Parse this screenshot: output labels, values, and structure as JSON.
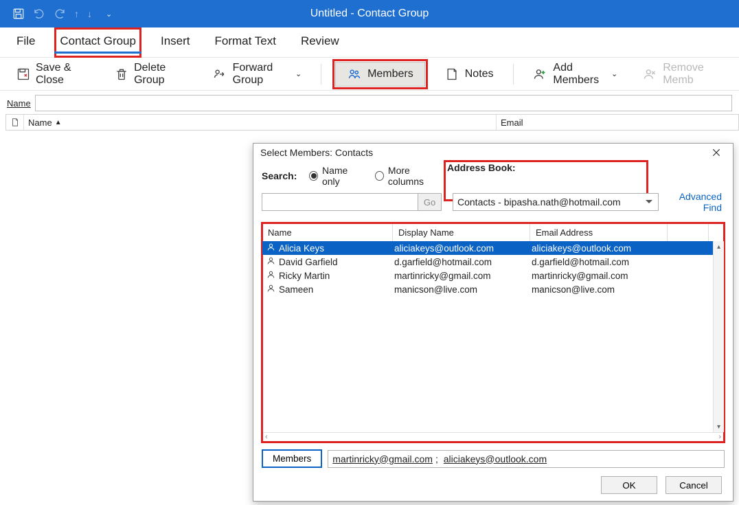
{
  "title": "Untitled  -  Contact Group",
  "tabs": {
    "file": "File",
    "contact_group": "Contact Group",
    "insert": "Insert",
    "format_text": "Format Text",
    "review": "Review"
  },
  "ribbon": {
    "save_close": "Save & Close",
    "delete_group": "Delete Group",
    "forward_group": "Forward Group",
    "members": "Members",
    "notes": "Notes",
    "add_members": "Add Members",
    "remove_member": "Remove Memb"
  },
  "name_row": {
    "label": "Name",
    "value": ""
  },
  "columns": {
    "name": "Name",
    "email": "Email"
  },
  "dialog": {
    "title": "Select Members: Contacts",
    "search_label": "Search:",
    "radio_name_only": "Name only",
    "radio_more_cols": "More columns",
    "ab_label": "Address Book:",
    "go": "Go",
    "ab_value": "Contacts - bipasha.nath@hotmail.com",
    "adv_find": "Advanced Find",
    "headers": {
      "name": "Name",
      "display_name": "Display Name",
      "email": "Email Address"
    },
    "rows": [
      {
        "name": "Alicia Keys",
        "display": "aliciakeys@outlook.com",
        "email": "aliciakeys@outlook.com",
        "selected": true
      },
      {
        "name": "David Garfield",
        "display": "d.garfield@hotmail.com",
        "email": "d.garfield@hotmail.com",
        "selected": false
      },
      {
        "name": "Ricky Martin",
        "display": "martinricky@gmail.com",
        "email": "martinricky@gmail.com",
        "selected": false
      },
      {
        "name": "Sameen",
        "display": "manicson@live.com",
        "email": "manicson@live.com",
        "selected": false
      }
    ],
    "members_btn": "Members",
    "members_value_1": "martinricky@gmail.com",
    "members_value_2": "aliciakeys@outlook.com",
    "ok": "OK",
    "cancel": "Cancel"
  }
}
